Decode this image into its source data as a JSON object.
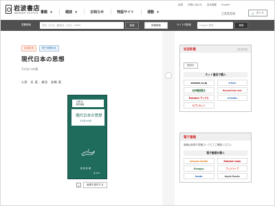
{
  "header": {
    "logo_text": "岩波書店",
    "logo_sub": "IWANAMI SHOTEN",
    "nav": [
      {
        "label": "書籍"
      },
      {
        "label": "雑誌"
      },
      {
        "label": "お知らせ"
      },
      {
        "label": "特設サイト"
      },
      {
        "label": "運動"
      }
    ],
    "util_links": [
      "採用",
      "お問い合わせ",
      "会社概要",
      "English"
    ],
    "help_label": "ご注文方法",
    "cart_label": "カート"
  },
  "searchbar": {
    "book_label": "書籍検索",
    "book_placeholder": "書名（かな）/著者名（かな）/ISBN",
    "book_button": "検索",
    "detail_button": "詳細検索",
    "site_label": "サイト内検索",
    "site_placeholder": "Google 提供",
    "site_button": "検索"
  },
  "book": {
    "tags": [
      "岩波新書",
      "電子書籍対応"
    ],
    "title": "現代日本の思想",
    "subtitle": "その五つの渦",
    "authors": "久野　収 著 , 鶴見　俊輔 著",
    "share_label": "画像を保存する",
    "cover": {
      "band_line1": "久野 収",
      "band_line2": "鶴見俊輔",
      "title": "現代日本の思想",
      "subtitle": "その五つの渦",
      "publisher": "岩波新書",
      "number": "青 253"
    }
  },
  "panels": {
    "paper": {
      "title": "岩波新書",
      "about": "ご注文方法",
      "status_button": "品切れ",
      "section": "ネット書店で購入",
      "stores": [
        {
          "name": "amazon.co.jp",
          "color": "#222"
        },
        {
          "name": "e-hon",
          "color": "#1f5fa8"
        },
        {
          "name": "紀伊國屋書店",
          "color": "#2a6a3a"
        },
        {
          "name": "HonyaClub.com",
          "color": "#c52b2b"
        },
        {
          "name": "Rakuten ブックス",
          "color": "#bf0000"
        },
        {
          "name": "e-honto",
          "color": "#1a62b7"
        },
        {
          "name": "セブンネット",
          "color": "#e0342e"
        }
      ]
    },
    "ebook": {
      "title": "電子書籍",
      "description": "価格は各電子書籍ストアにてご確認ください",
      "section": "電子書籍を購入",
      "stores": [
        {
          "name": "amazon kindle",
          "color": "#e07b1c"
        },
        {
          "name": "Rakuten kobo",
          "color": "#bf0000"
        },
        {
          "name": "Kinoppy",
          "color": "#2a6a3a"
        },
        {
          "name": "ブックライブ",
          "color": "#e9472e"
        },
        {
          "name": "honto",
          "color": "#1a62b7"
        },
        {
          "name": "Apple Books",
          "color": "#555"
        }
      ]
    }
  }
}
